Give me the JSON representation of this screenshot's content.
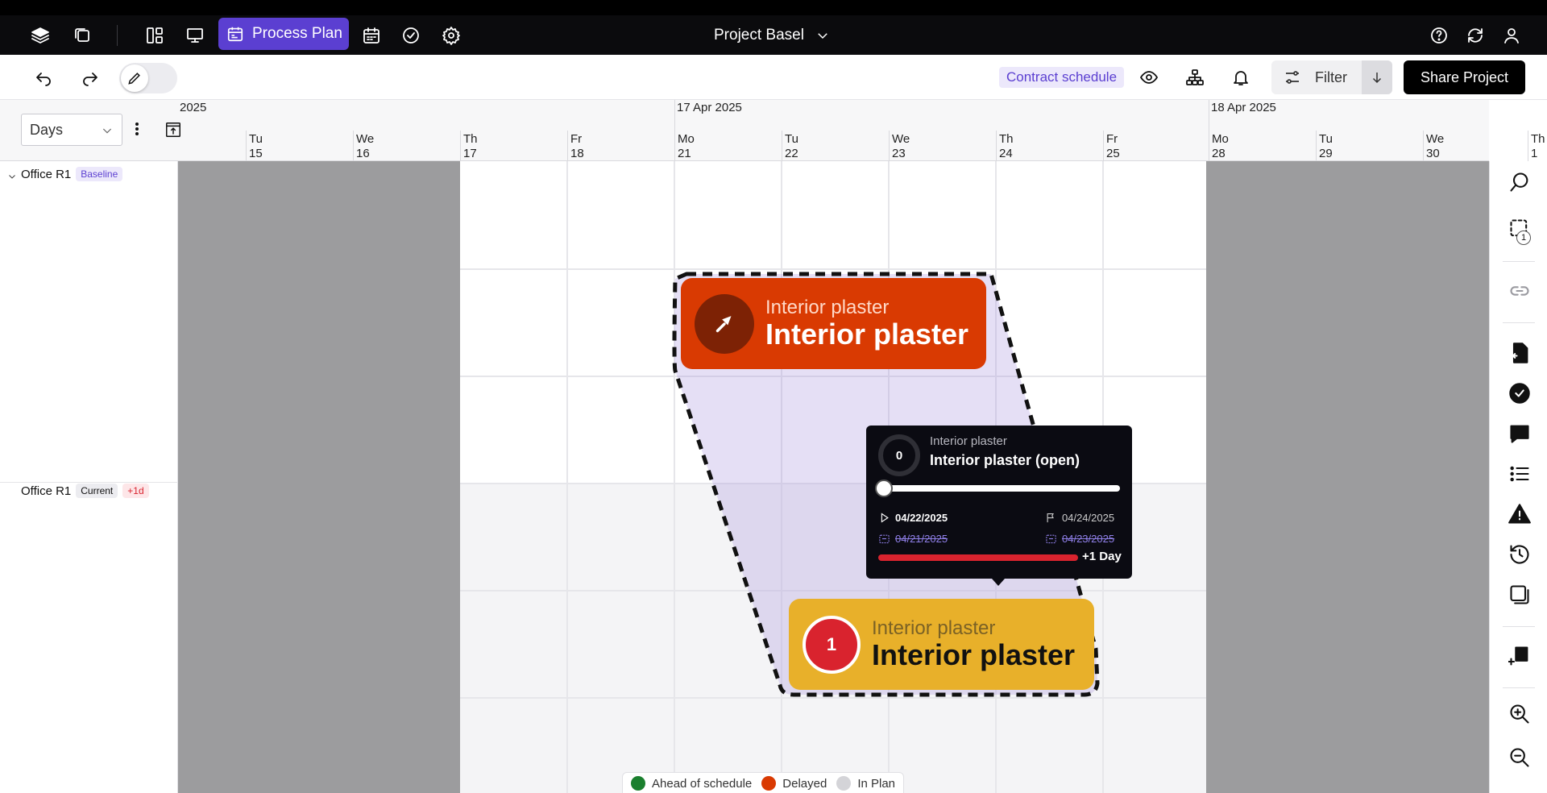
{
  "nav": {
    "active_label": "Process Plan",
    "project_title": "Project Basel"
  },
  "toolbar": {
    "contract_schedule": "Contract schedule",
    "filter_label": "Filter",
    "share_label": "Share Project"
  },
  "timeline": {
    "scale": "Days",
    "weeks": [
      {
        "label": "2025"
      },
      {
        "label": "17 Apr 2025"
      },
      {
        "label": "18 Apr 2025"
      }
    ],
    "days": [
      {
        "dow": "Tu",
        "num": "15"
      },
      {
        "dow": "We",
        "num": "16"
      },
      {
        "dow": "Th",
        "num": "17"
      },
      {
        "dow": "Fr",
        "num": "18"
      },
      {
        "dow": "Mo",
        "num": "21"
      },
      {
        "dow": "Tu",
        "num": "22"
      },
      {
        "dow": "We",
        "num": "23"
      },
      {
        "dow": "Th",
        "num": "24"
      },
      {
        "dow": "Fr",
        "num": "25"
      },
      {
        "dow": "Mo",
        "num": "28"
      },
      {
        "dow": "Tu",
        "num": "29"
      },
      {
        "dow": "We",
        "num": "30"
      },
      {
        "dow": "Th",
        "num": "1"
      }
    ]
  },
  "rows": [
    {
      "label": "Office R1",
      "badge": "Baseline"
    },
    {
      "label": "Office R1",
      "badge": "Current",
      "delta": "+1d"
    }
  ],
  "cards": {
    "baseline": {
      "subtitle": "Interior plaster",
      "title": "Interior plaster"
    },
    "current": {
      "subtitle": "Interior plaster",
      "title": "Interior plaster",
      "count": "1"
    }
  },
  "tooltip": {
    "progress": "0",
    "progress_fraction": 0,
    "subtitle": "Interior plaster",
    "title": "Interior plaster (open)",
    "start": "04/22/2025",
    "end": "04/24/2025",
    "baseline_start": "04/21/2025",
    "baseline_end": "04/23/2025",
    "delay": "+1 Day"
  },
  "legend": [
    {
      "label": "Ahead of schedule",
      "color": "#1a7f2e"
    },
    {
      "label": "Delayed",
      "color": "#d93a02"
    },
    {
      "label": "In Plan",
      "color": "#d4d4d8"
    }
  ],
  "sidebar": {
    "selection_count": "1"
  },
  "colors": {
    "accent": "#5b3fd1",
    "delayed": "#d93a02",
    "current": "#e8b02a"
  }
}
